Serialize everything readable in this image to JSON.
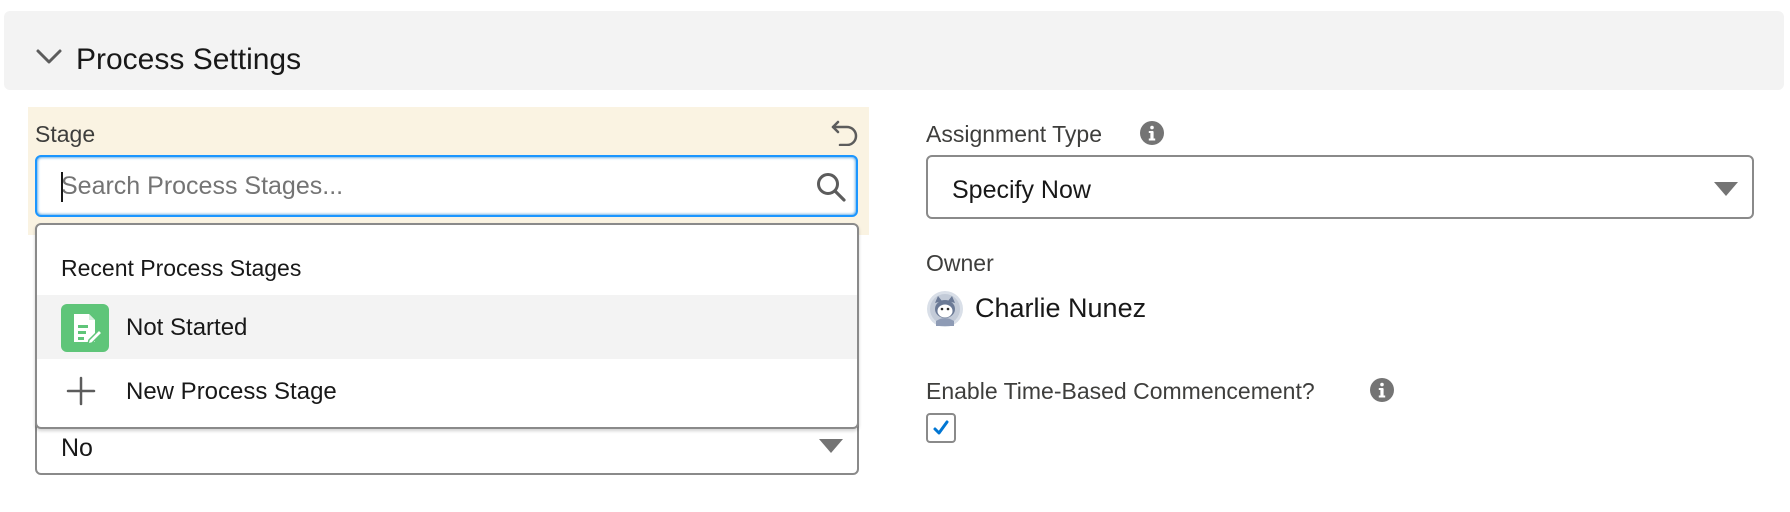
{
  "section": {
    "title": "Process Settings"
  },
  "stage": {
    "label": "Stage",
    "search_placeholder": "Search Process Stages...",
    "dropdown": {
      "heading": "Recent Process Stages",
      "items": [
        {
          "label": "Not Started",
          "icon": "process-stage-icon"
        },
        {
          "label": "New Process Stage",
          "icon": "plus-icon"
        }
      ]
    }
  },
  "left_select": {
    "value": "No"
  },
  "assignment_type": {
    "label": "Assignment Type",
    "value": "Specify Now"
  },
  "owner": {
    "label": "Owner",
    "name": "Charlie Nunez"
  },
  "time_based": {
    "label": "Enable Time-Based Commencement?",
    "checked": true
  },
  "colors": {
    "focus_blue": "#1b96ff",
    "edited_field_bg": "#faf3e2",
    "stage_icon_green": "#5fc579",
    "checkbox_check": "#0176d3"
  }
}
